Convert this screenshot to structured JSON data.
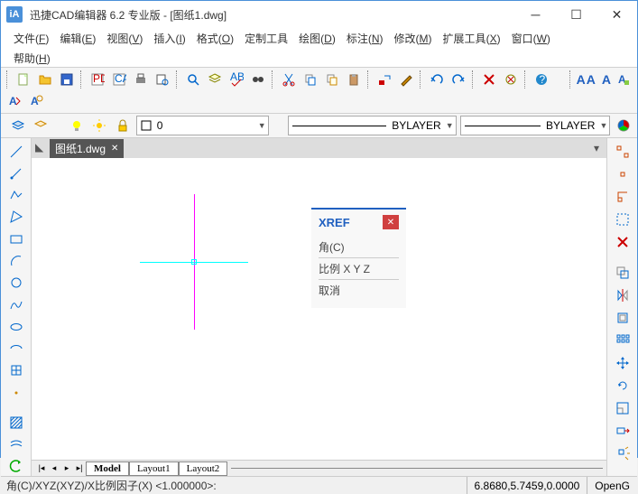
{
  "window": {
    "title": "迅捷CAD编辑器 6.2 专业版  - [图纸1.dwg]",
    "logo_text": "iA"
  },
  "menu": {
    "items": [
      {
        "label": "文件",
        "accel": "F"
      },
      {
        "label": "编辑",
        "accel": "E"
      },
      {
        "label": "视图",
        "accel": "V"
      },
      {
        "label": "插入",
        "accel": "I"
      },
      {
        "label": "格式",
        "accel": "O"
      },
      {
        "label": "定制工具",
        "accel": ""
      },
      {
        "label": "绘图",
        "accel": "D"
      },
      {
        "label": "标注",
        "accel": "N"
      },
      {
        "label": "修改",
        "accel": "M"
      },
      {
        "label": "扩展工具",
        "accel": "X"
      },
      {
        "label": "窗口",
        "accel": "W"
      }
    ],
    "row2": [
      {
        "label": "帮助",
        "accel": "H"
      }
    ]
  },
  "text_style": "AA",
  "properties": {
    "layer_value": "0",
    "linetype_label": "BYLAYER",
    "lineweight_label": "BYLAYER"
  },
  "document": {
    "tab_label": "图纸1.dwg"
  },
  "popup": {
    "title": "XREF",
    "rows": [
      "角(C)",
      "比例 X Y Z",
      "取消"
    ]
  },
  "layout_tabs": {
    "model": "Model",
    "layout1": "Layout1",
    "layout2": "Layout2"
  },
  "status": {
    "prompt": "角(C)/XYZ(XYZ)/X比例因子(X) <1.000000>:",
    "coords": "6.8680,5.7459,0.0000",
    "renderer": "OpenG"
  }
}
